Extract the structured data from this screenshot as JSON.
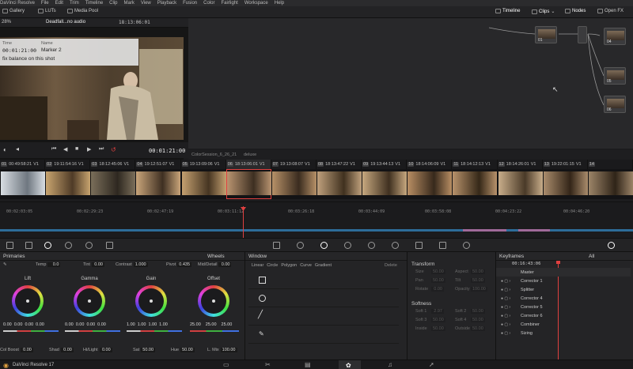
{
  "menubar": {
    "items": [
      "DaVinci Resolve",
      "File",
      "Edit",
      "Trim",
      "Timeline",
      "Clip",
      "Mark",
      "View",
      "Playback",
      "Fusion",
      "Color",
      "Fairlight",
      "Workspace",
      "Help"
    ]
  },
  "toolbar": {
    "gallery": "Gallery",
    "luts": "LUTs",
    "media_pool": "Media Pool",
    "timeline": "Timeline",
    "clips": "Clips",
    "nodes": "Nodes",
    "openfx": "Open FX"
  },
  "viewer": {
    "zoom": "28%",
    "clip_name": "Deadfall...no audio",
    "timecode_top": "18:13:06:01",
    "clip_mode": "Clip",
    "marker_time_label": "Time",
    "marker_time": "00:01:21:00",
    "marker_name_label": "Name",
    "marker_name": "Marker 2",
    "marker_note": "fix balance on this shot",
    "timecode": "00:01:21:00"
  },
  "session": {
    "name": "ColorSession_6_26_21",
    "label": "deluxe"
  },
  "clips": [
    {
      "num": "01",
      "tc": "00:49:58:21",
      "track": "V1"
    },
    {
      "num": "02",
      "tc": "19:11:54:16",
      "track": "V1"
    },
    {
      "num": "03",
      "tc": "18:12:45:06",
      "track": "V1"
    },
    {
      "num": "04",
      "tc": "19:12:51:07",
      "track": "V1"
    },
    {
      "num": "05",
      "tc": "19:13:09:06",
      "track": "V1"
    },
    {
      "num": "06",
      "tc": "18:13:06:01",
      "track": "V1"
    },
    {
      "num": "07",
      "tc": "19:13:08:07",
      "track": "V1"
    },
    {
      "num": "08",
      "tc": "18:13:47:22",
      "track": "V1"
    },
    {
      "num": "09",
      "tc": "19:13:44:13",
      "track": "V1"
    },
    {
      "num": "10",
      "tc": "18:14:06:09",
      "track": "V1"
    },
    {
      "num": "11",
      "tc": "18:14:12:13",
      "track": "V1"
    },
    {
      "num": "12",
      "tc": "18:14:26:01",
      "track": "V1"
    },
    {
      "num": "13",
      "tc": "19:22:01:15",
      "track": "V1"
    },
    {
      "num": "14",
      "tc": "",
      "track": ""
    }
  ],
  "ruler": {
    "labels": [
      "00:02:03:05",
      "00:02:29:23",
      "00:02:47:19",
      "00:03:11:12",
      "00:03:26:18",
      "00:03:44:09",
      "00:03:58:08",
      "00:04:23:22",
      "00:04:46:20",
      "00:05:03:18"
    ]
  },
  "primaries": {
    "title": "Primaries",
    "mode": "Wheels",
    "temp_label": "Temp",
    "temp": "0.0",
    "tint_label": "Tint",
    "tint": "0.00",
    "contrast_label": "Contrast",
    "contrast": "1.000",
    "pivot_label": "Pivot",
    "pivot": "0.435",
    "middetail_label": "Mid/Detail",
    "middetail": "0.00",
    "wheels": [
      {
        "label": "Lift",
        "values": [
          "0.00",
          "0.00",
          "0.00",
          "0.00"
        ]
      },
      {
        "label": "Gamma",
        "values": [
          "0.00",
          "0.00",
          "0.00",
          "0.00"
        ]
      },
      {
        "label": "Gain",
        "values": [
          "1.00",
          "1.00",
          "1.00",
          "1.00"
        ]
      },
      {
        "label": "Offset",
        "values": [
          "25.00",
          "25.00",
          "25.00"
        ]
      }
    ],
    "colboost_label": "Col Boost",
    "colboost": "0.00",
    "shad_label": "Shad",
    "shad": "0.00",
    "hilight_label": "Hi/Light",
    "hilight": "0.00",
    "sat_label": "Sat",
    "sat": "50.00",
    "hue_label": "Hue",
    "hue": "50.00",
    "lmix_label": "L. Mix",
    "lmix": "100.00"
  },
  "window": {
    "title": "Window",
    "tools": [
      "Linear",
      "Circle",
      "Polygon",
      "Curve",
      "Gradient"
    ],
    "delete": "Delete"
  },
  "transform": {
    "title": "Transform",
    "fields": [
      {
        "label": "Size",
        "value": "50.00"
      },
      {
        "label": "Aspect",
        "value": "50.00"
      },
      {
        "label": "Pan",
        "value": "50.00"
      },
      {
        "label": "Tilt",
        "value": "50.00"
      },
      {
        "label": "Rotate",
        "value": "0.00"
      },
      {
        "label": "Opacity",
        "value": "100.00"
      }
    ],
    "softness_title": "Softness",
    "softness": [
      {
        "label": "Soft 1",
        "value": "2.97"
      },
      {
        "label": "Soft 2",
        "value": "50.00"
      },
      {
        "label": "Soft 3",
        "value": "50.00"
      },
      {
        "label": "Soft 4",
        "value": "50.00"
      },
      {
        "label": "Inside",
        "value": "50.00"
      },
      {
        "label": "Outside",
        "value": "50.00"
      }
    ]
  },
  "keyframes": {
    "title": "Keyframes",
    "filter": "All",
    "timecode": "00:16:43:06",
    "rows": [
      "Master",
      "Corrector 1",
      "Splitter",
      "Corrector 4",
      "Corrector 5",
      "Corrector 6",
      "Combiner",
      "Sizing"
    ]
  },
  "status": {
    "app": "DaVinci Resolve 17"
  }
}
